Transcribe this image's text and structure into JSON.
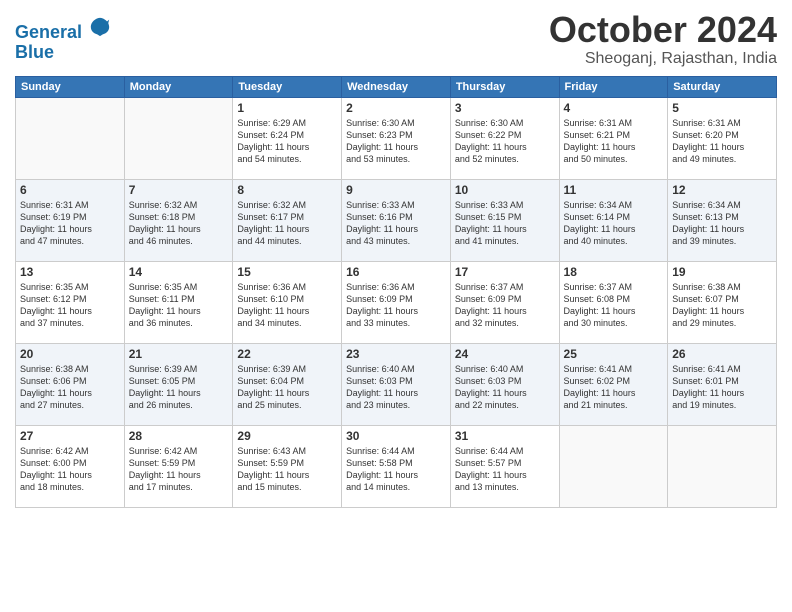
{
  "header": {
    "logo_line1": "General",
    "logo_line2": "Blue",
    "month": "October 2024",
    "location": "Sheoganj, Rajasthan, India"
  },
  "weekdays": [
    "Sunday",
    "Monday",
    "Tuesday",
    "Wednesday",
    "Thursday",
    "Friday",
    "Saturday"
  ],
  "weeks": [
    [
      {
        "day": "",
        "content": ""
      },
      {
        "day": "",
        "content": ""
      },
      {
        "day": "1",
        "content": "Sunrise: 6:29 AM\nSunset: 6:24 PM\nDaylight: 11 hours\nand 54 minutes."
      },
      {
        "day": "2",
        "content": "Sunrise: 6:30 AM\nSunset: 6:23 PM\nDaylight: 11 hours\nand 53 minutes."
      },
      {
        "day": "3",
        "content": "Sunrise: 6:30 AM\nSunset: 6:22 PM\nDaylight: 11 hours\nand 52 minutes."
      },
      {
        "day": "4",
        "content": "Sunrise: 6:31 AM\nSunset: 6:21 PM\nDaylight: 11 hours\nand 50 minutes."
      },
      {
        "day": "5",
        "content": "Sunrise: 6:31 AM\nSunset: 6:20 PM\nDaylight: 11 hours\nand 49 minutes."
      }
    ],
    [
      {
        "day": "6",
        "content": "Sunrise: 6:31 AM\nSunset: 6:19 PM\nDaylight: 11 hours\nand 47 minutes."
      },
      {
        "day": "7",
        "content": "Sunrise: 6:32 AM\nSunset: 6:18 PM\nDaylight: 11 hours\nand 46 minutes."
      },
      {
        "day": "8",
        "content": "Sunrise: 6:32 AM\nSunset: 6:17 PM\nDaylight: 11 hours\nand 44 minutes."
      },
      {
        "day": "9",
        "content": "Sunrise: 6:33 AM\nSunset: 6:16 PM\nDaylight: 11 hours\nand 43 minutes."
      },
      {
        "day": "10",
        "content": "Sunrise: 6:33 AM\nSunset: 6:15 PM\nDaylight: 11 hours\nand 41 minutes."
      },
      {
        "day": "11",
        "content": "Sunrise: 6:34 AM\nSunset: 6:14 PM\nDaylight: 11 hours\nand 40 minutes."
      },
      {
        "day": "12",
        "content": "Sunrise: 6:34 AM\nSunset: 6:13 PM\nDaylight: 11 hours\nand 39 minutes."
      }
    ],
    [
      {
        "day": "13",
        "content": "Sunrise: 6:35 AM\nSunset: 6:12 PM\nDaylight: 11 hours\nand 37 minutes."
      },
      {
        "day": "14",
        "content": "Sunrise: 6:35 AM\nSunset: 6:11 PM\nDaylight: 11 hours\nand 36 minutes."
      },
      {
        "day": "15",
        "content": "Sunrise: 6:36 AM\nSunset: 6:10 PM\nDaylight: 11 hours\nand 34 minutes."
      },
      {
        "day": "16",
        "content": "Sunrise: 6:36 AM\nSunset: 6:09 PM\nDaylight: 11 hours\nand 33 minutes."
      },
      {
        "day": "17",
        "content": "Sunrise: 6:37 AM\nSunset: 6:09 PM\nDaylight: 11 hours\nand 32 minutes."
      },
      {
        "day": "18",
        "content": "Sunrise: 6:37 AM\nSunset: 6:08 PM\nDaylight: 11 hours\nand 30 minutes."
      },
      {
        "day": "19",
        "content": "Sunrise: 6:38 AM\nSunset: 6:07 PM\nDaylight: 11 hours\nand 29 minutes."
      }
    ],
    [
      {
        "day": "20",
        "content": "Sunrise: 6:38 AM\nSunset: 6:06 PM\nDaylight: 11 hours\nand 27 minutes."
      },
      {
        "day": "21",
        "content": "Sunrise: 6:39 AM\nSunset: 6:05 PM\nDaylight: 11 hours\nand 26 minutes."
      },
      {
        "day": "22",
        "content": "Sunrise: 6:39 AM\nSunset: 6:04 PM\nDaylight: 11 hours\nand 25 minutes."
      },
      {
        "day": "23",
        "content": "Sunrise: 6:40 AM\nSunset: 6:03 PM\nDaylight: 11 hours\nand 23 minutes."
      },
      {
        "day": "24",
        "content": "Sunrise: 6:40 AM\nSunset: 6:03 PM\nDaylight: 11 hours\nand 22 minutes."
      },
      {
        "day": "25",
        "content": "Sunrise: 6:41 AM\nSunset: 6:02 PM\nDaylight: 11 hours\nand 21 minutes."
      },
      {
        "day": "26",
        "content": "Sunrise: 6:41 AM\nSunset: 6:01 PM\nDaylight: 11 hours\nand 19 minutes."
      }
    ],
    [
      {
        "day": "27",
        "content": "Sunrise: 6:42 AM\nSunset: 6:00 PM\nDaylight: 11 hours\nand 18 minutes."
      },
      {
        "day": "28",
        "content": "Sunrise: 6:42 AM\nSunset: 5:59 PM\nDaylight: 11 hours\nand 17 minutes."
      },
      {
        "day": "29",
        "content": "Sunrise: 6:43 AM\nSunset: 5:59 PM\nDaylight: 11 hours\nand 15 minutes."
      },
      {
        "day": "30",
        "content": "Sunrise: 6:44 AM\nSunset: 5:58 PM\nDaylight: 11 hours\nand 14 minutes."
      },
      {
        "day": "31",
        "content": "Sunrise: 6:44 AM\nSunset: 5:57 PM\nDaylight: 11 hours\nand 13 minutes."
      },
      {
        "day": "",
        "content": ""
      },
      {
        "day": "",
        "content": ""
      }
    ]
  ]
}
